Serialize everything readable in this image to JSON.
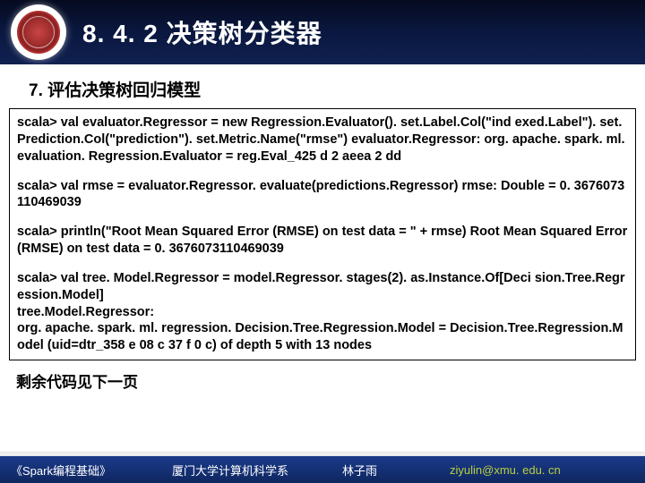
{
  "header": {
    "title": "8. 4. 2 决策树分类器"
  },
  "subtitle": "7. 评估决策树回归模型",
  "code": {
    "p1": "scala> val evaluator.Regressor = new Regression.Evaluator(). set.Label.Col(\"ind exed.Label\"). set.Prediction.Col(\"prediction\"). set.Metric.Name(\"rmse\") evaluator.Regressor: org. apache. spark. ml. evaluation. Regression.Evaluator = reg.Eval_425 d 2 aeea 2 dd",
    "p2": "scala> val rmse = evaluator.Regressor. evaluate(predictions.Regressor) rmse: Double = 0. 3676073110469039",
    "p3": "scala> println(\"Root Mean Squared Error (RMSE) on test data = \" + rmse) Root Mean Squared Error (RMSE) on test data = 0. 3676073110469039",
    "p4": "scala> val tree. Model.Regressor = model.Regressor. stages(2). as.Instance.Of[Deci sion.Tree.Regression.Model]\ntree.Model.Regressor:\norg. apache. spark. ml. regression. Decision.Tree.Regression.Model = Decision.Tree.Regression.Model (uid=dtr_358 e 08 c 37 f 0 c) of depth 5 with 13 nodes"
  },
  "note": "剩余代码见下一页",
  "footer": {
    "book": "《Spark编程基础》",
    "dept": "厦门大学计算机科学系",
    "author": "林子雨",
    "email": "ziyulin@xmu. edu. cn"
  }
}
